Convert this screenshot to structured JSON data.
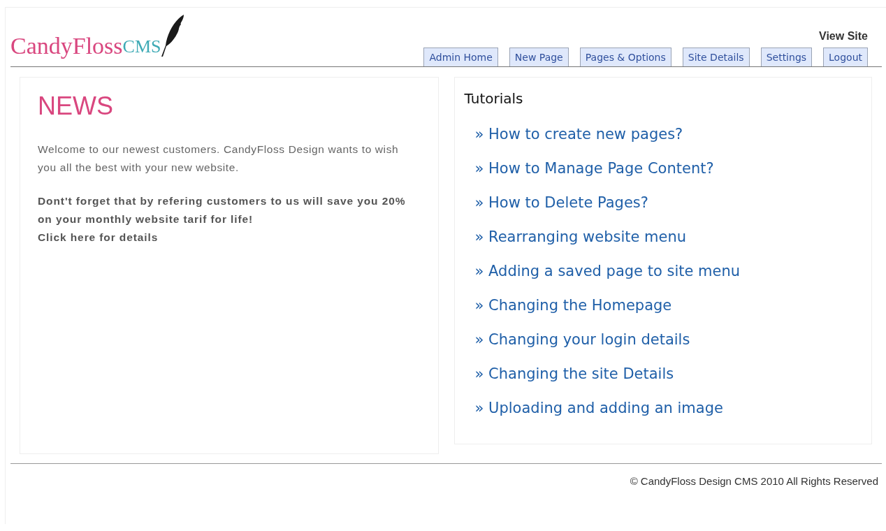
{
  "header": {
    "logo": {
      "name": "CandyFloss",
      "suffix": "CMS"
    },
    "view_site": "View Site"
  },
  "tabs": [
    "Admin Home",
    "New Page",
    "Pages & Options",
    "Site Details",
    "Settings",
    "Logout"
  ],
  "news": {
    "title": "NEWS",
    "intro": "Welcome to our newest customers. CandyFloss Design wants to wish you all the best with your new website.",
    "offer": "Dont't forget that by refering customers to us will save you 20% on your monthly website tarif for life!",
    "link": "Click here for details"
  },
  "tutorials": {
    "title": "Tutorials",
    "links": [
      "» How to create new pages?",
      "» How to Manage Page Content?",
      "» How to Delete Pages?",
      "» Rearranging website menu",
      "» Adding a saved page to site menu",
      "» Changing the Homepage",
      "» Changing your login details",
      "» Changing the site Details",
      "» Uploading and adding an image"
    ]
  },
  "footer": "© CandyFloss Design CMS 2010 All Rights Reserved"
}
